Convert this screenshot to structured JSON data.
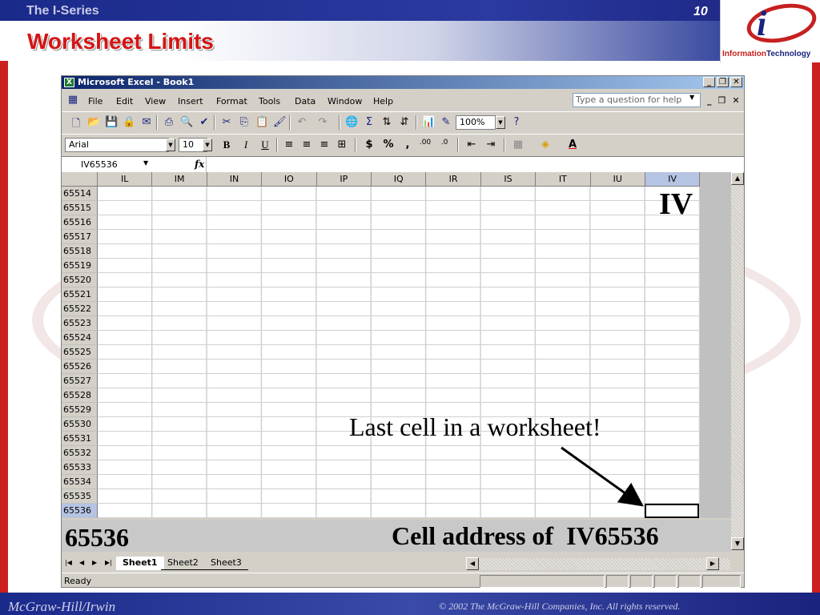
{
  "slide": {
    "series": "The I-Series",
    "number": "10",
    "title": "Worksheet Limits",
    "logo_text_a": "Information",
    "logo_text_b": "Technology",
    "logo_letter": "i",
    "footer_left": "McGraw-Hill/Irwin",
    "footer_right": "© 2002  The McGraw-Hill Companies, Inc. All rights reserved."
  },
  "excel": {
    "window_title": "Microsoft Excel - Book1",
    "menus": [
      "File",
      "Edit",
      "View",
      "Insert",
      "Format",
      "Tools",
      "Data",
      "Window",
      "Help"
    ],
    "ask_placeholder": "Type a question for help",
    "zoom": "100%",
    "font_name": "Arial",
    "font_size": "10",
    "name_box": "IV65536",
    "fx_label": "fx",
    "columns": [
      "IL",
      "IM",
      "IN",
      "IO",
      "IP",
      "IQ",
      "IR",
      "IS",
      "IT",
      "IU",
      "IV"
    ],
    "rows": [
      "65514",
      "65515",
      "65516",
      "65517",
      "65518",
      "65519",
      "65520",
      "65521",
      "65522",
      "65523",
      "65524",
      "65525",
      "65526",
      "65527",
      "65528",
      "65529",
      "65530",
      "65531",
      "65532",
      "65533",
      "65534",
      "65535",
      "65536"
    ],
    "selected_column": "IV",
    "selected_row": "65536",
    "sheets": [
      "Sheet1",
      "Sheet2",
      "Sheet3"
    ],
    "active_sheet": "Sheet1",
    "status": "Ready",
    "toolbar_icons": [
      "new-icon",
      "open-icon",
      "save-icon",
      "permission-icon",
      "email-icon",
      "print-icon",
      "print-preview-icon",
      "spelling-icon",
      "cut-icon",
      "copy-icon",
      "paste-icon",
      "format-painter-icon",
      "undo-icon",
      "redo-icon",
      "hyperlink-icon",
      "autosum-icon",
      "sort-ascending-icon",
      "sort-descending-icon",
      "chart-wizard-icon",
      "drawing-icon",
      "help-icon"
    ],
    "format_icons": [
      "bold-icon",
      "italic-icon",
      "underline-icon",
      "align-left-icon",
      "center-icon",
      "align-right-icon",
      "merge-center-icon",
      "currency-icon",
      "percent-icon",
      "comma-icon",
      "increase-decimal-icon",
      "decrease-decimal-icon",
      "decrease-indent-icon",
      "increase-indent-icon",
      "borders-icon",
      "fill-color-icon",
      "font-color-icon"
    ]
  },
  "callouts": {
    "column_label": "IV",
    "row_label": "65536",
    "cell_address": "Cell address of  IV65536",
    "last_cell": "Last cell in a worksheet!"
  }
}
